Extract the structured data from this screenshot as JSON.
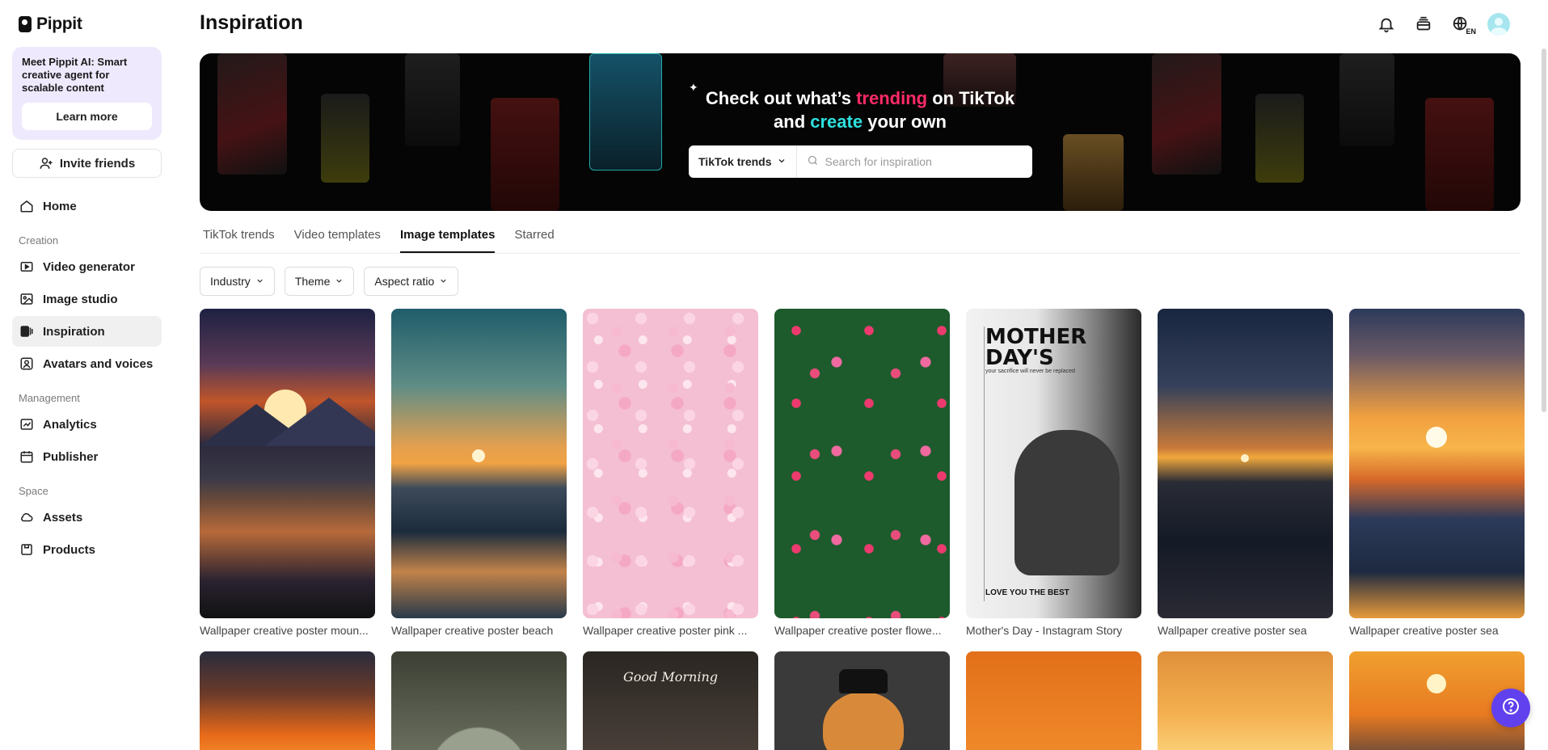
{
  "app": {
    "name": "Pippit"
  },
  "sidebar": {
    "promo": {
      "text": "Meet Pippit AI: Smart creative agent for scalable content",
      "button": "Learn more"
    },
    "invite": "Invite friends",
    "home": "Home",
    "sections": {
      "creation": "Creation",
      "management": "Management",
      "space": "Space"
    },
    "creation_items": [
      "Video generator",
      "Image studio",
      "Inspiration",
      "Avatars and voices"
    ],
    "management_items": [
      "Analytics",
      "Publisher"
    ],
    "space_items": [
      "Assets",
      "Products"
    ],
    "active": "Inspiration"
  },
  "header": {
    "title": "Inspiration",
    "lang": "EN",
    "icons": [
      "bell-icon",
      "layers-icon",
      "globe-icon",
      "avatar"
    ]
  },
  "banner": {
    "line1_pre": "Check out what’s ",
    "line1_hl": "trending",
    "line1_post": " on TikTok",
    "line2_pre": "and ",
    "line2_hl": "create",
    "line2_post": " your own",
    "select_value": "TikTok trends",
    "search_placeholder": "Search for inspiration",
    "colors": {
      "pink": "#ff2a67",
      "cyan": "#2ee0df"
    }
  },
  "tabs": [
    "TikTok trends",
    "Video templates",
    "Image templates",
    "Starred"
  ],
  "active_tab": "Image templates",
  "filters": [
    "Industry",
    "Theme",
    "Aspect ratio"
  ],
  "cards": [
    "Wallpaper creative poster moun...",
    "Wallpaper creative poster beach",
    "Wallpaper creative poster pink ...",
    "Wallpaper creative poster flowe...",
    "Mother's Day - Instagram Story",
    "Wallpaper creative poster sea",
    "Wallpaper creative poster sea"
  ],
  "mothers_day": {
    "title": "MOTHER DAY'S",
    "subtitle": "your sacrifice will never be replaced",
    "footer": "LOVE YOU THE BEST"
  },
  "row2": {
    "good_morning": "Good Morning"
  },
  "accent_color": "#6141ed"
}
